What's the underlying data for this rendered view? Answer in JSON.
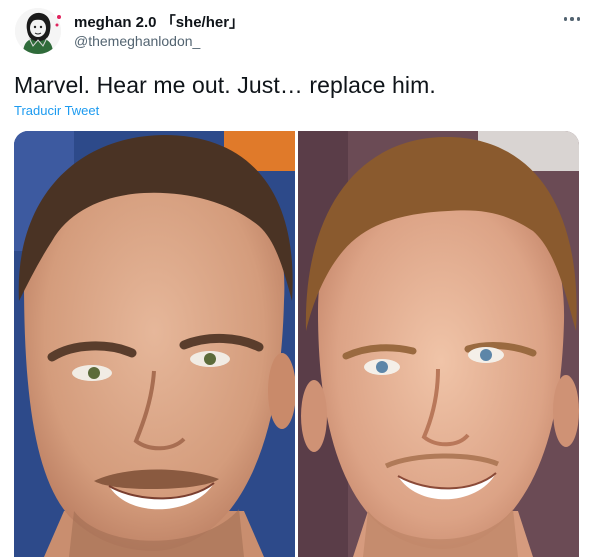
{
  "author": {
    "display_name": "meghan 2.0 「she/her」",
    "handle": "@themeghanlodon_"
  },
  "tweet": {
    "text": "Marvel. Hear me out. Just… replace him.",
    "translate_label": "Traducir Tweet"
  },
  "icons": {
    "more": "more-horizontal-icon",
    "avatar": "avatar-illustration"
  },
  "media": {
    "left_photo": "photo-man-smiling-left",
    "right_photo": "photo-man-smiling-right",
    "left_background_color": "#2d4a8a",
    "right_background_color": "#6b4b55"
  },
  "colors": {
    "text_primary": "#0f1419",
    "text_secondary": "#536471",
    "link": "#1d9bf0"
  }
}
